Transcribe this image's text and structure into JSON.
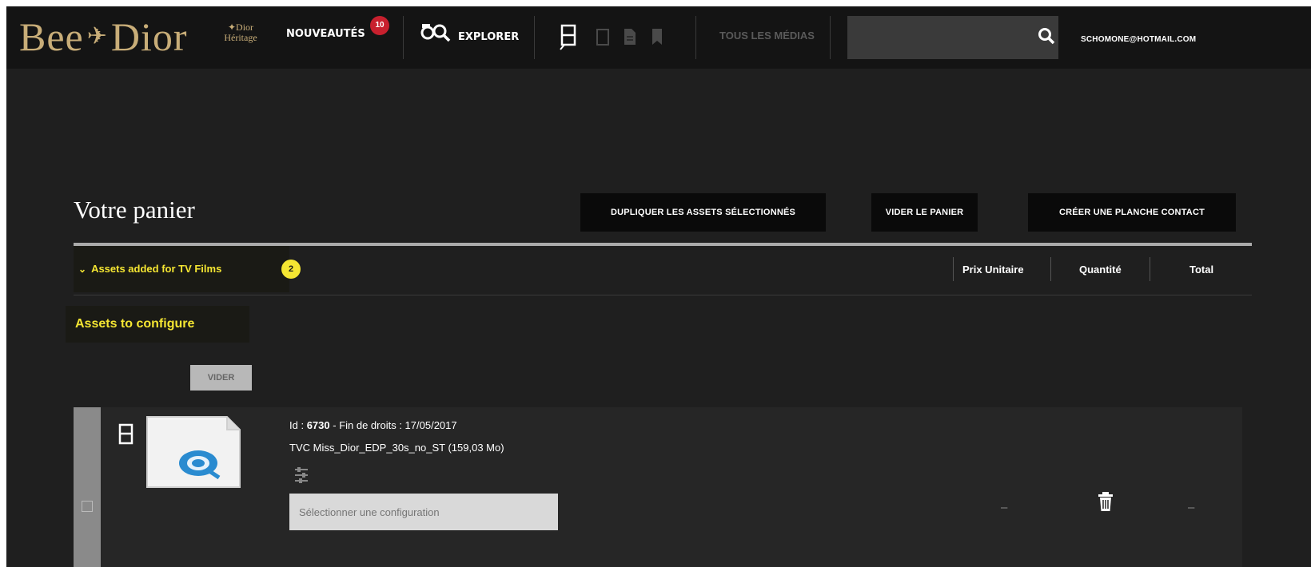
{
  "brand": {
    "logo_text": "Bee Dior",
    "logo_mark": "✈",
    "heritage_line1": "✦Dior",
    "heritage_line2": "Héritage",
    "logo_color": "#c8ad78"
  },
  "nav": {
    "news_label": "NOUVEAUTÉS",
    "news_badge": "10",
    "explore_label": "EXPLORER",
    "media_type_icons": [
      "film-strip-icon",
      "tablet-icon",
      "document-icon",
      "bookmark-icon"
    ],
    "all_media_label": "TOUS LES MÉDIAS",
    "search_placeholder": "",
    "user_email": "SCHOMONE@HOTMAIL.COM"
  },
  "cart": {
    "title": "Votre panier",
    "duplicate_button": "DUPLIQUER LES ASSETS SÉLECTIONNÉS",
    "empty_button": "VIDER LE PANIER",
    "contact_sheet_button": "CRÉER UNE PLANCHE CONTACT",
    "section": {
      "chevron": "⌄",
      "title": "Assets added for TV Films",
      "count": "2"
    },
    "columns": {
      "unit_price": "Prix Unitaire",
      "quantity": "Quantité",
      "total": "Total"
    },
    "configure_label": "Assets to configure",
    "vider_label": "VIDER",
    "accent_color": "#f5e632"
  },
  "asset": {
    "id_label": "Id :",
    "id_value": "6730",
    "rights_label": "- Fin de droits : 17/05/2017",
    "name": "TVC Miss_Dior_EDP_30s_no_ST (159,03 Mo)",
    "config_placeholder": "Sélectionner une configuration",
    "unit_price": "–",
    "total": "–"
  }
}
